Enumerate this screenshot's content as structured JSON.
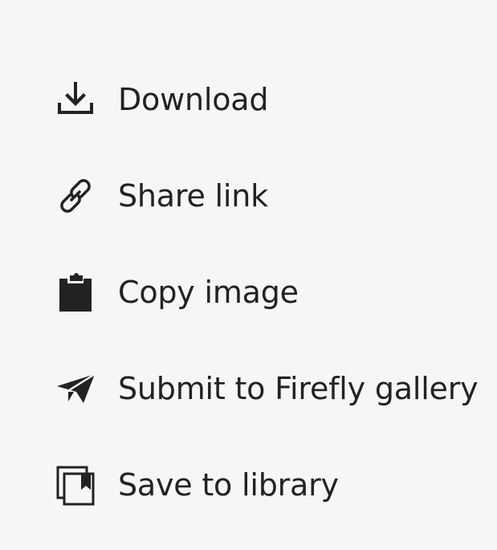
{
  "menu": {
    "items": [
      {
        "id": "download",
        "label": "Download",
        "icon": "download-icon"
      },
      {
        "id": "share",
        "label": "Share link",
        "icon": "link-icon"
      },
      {
        "id": "copy",
        "label": "Copy image",
        "icon": "clipboard-icon"
      },
      {
        "id": "submit",
        "label": "Submit to Firefly gallery",
        "icon": "paper-plane-icon"
      },
      {
        "id": "save",
        "label": "Save to library",
        "icon": "library-icon"
      }
    ]
  },
  "colors": {
    "background": "#f6f6f6",
    "text": "#222222",
    "icon": "#222222"
  }
}
